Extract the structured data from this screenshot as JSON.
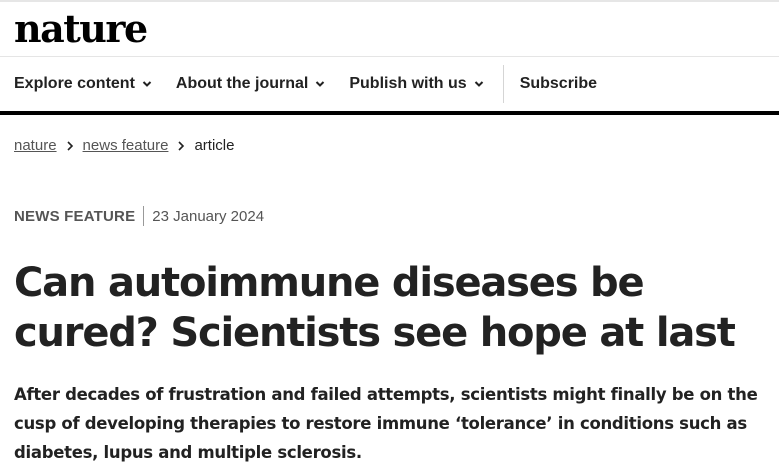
{
  "header": {
    "logo": "nature"
  },
  "nav": {
    "items": [
      {
        "label": "Explore content",
        "icon": "chevron-down-icon"
      },
      {
        "label": "About the journal",
        "icon": "chevron-down-icon"
      },
      {
        "label": "Publish with us",
        "icon": "chevron-down-icon"
      }
    ],
    "subscribe_label": "Subscribe"
  },
  "breadcrumb": {
    "items": [
      "nature",
      "news feature"
    ],
    "current": "article",
    "separator_icon": "chevron-right-icon"
  },
  "article": {
    "type": "NEWS FEATURE",
    "date": "23 January 2024",
    "title": "Can autoimmune diseases be cured? Scientists see hope at last",
    "standfirst": "After decades of frustration and failed attempts, scientists might finally be on the cusp of developing therapies to restore immune ‘tolerance’ in conditions such as diabetes, lupus and multiple sclerosis."
  },
  "colors": {
    "text": "#222222",
    "muted": "#555555",
    "nav_bar": "#000000",
    "background": "#ffffff"
  }
}
